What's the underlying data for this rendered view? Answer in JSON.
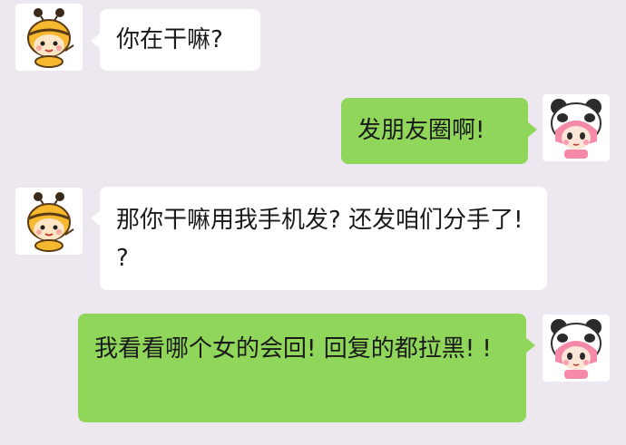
{
  "conversation": {
    "messages": [
      {
        "side": "left",
        "sender": "bee-avatar",
        "text": "你在干嘛?"
      },
      {
        "side": "right",
        "sender": "panda-girl-avatar",
        "text": "发朋友圈啊!"
      },
      {
        "side": "left",
        "sender": "bee-avatar",
        "text": "那你干嘛用我手机发? 还发咱们分手了! ?"
      },
      {
        "side": "right",
        "sender": "panda-girl-avatar",
        "text": "我看看哪个女的会回! 回复的都拉黑! !"
      }
    ]
  },
  "colors": {
    "background": "#ede8ef",
    "incoming_bubble": "#ffffff",
    "outgoing_bubble": "#8fd65a",
    "text": "#1a1a1a"
  },
  "icons": {
    "incoming_avatar": "bee-boy-icon",
    "outgoing_avatar": "panda-hood-girl-icon"
  }
}
